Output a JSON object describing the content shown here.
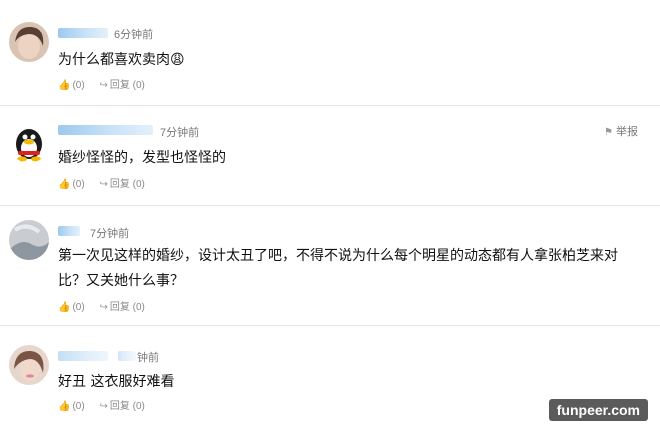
{
  "comments": [
    {
      "time": "6分钟前",
      "text": "为什么都喜欢卖肉😩",
      "like_count": "(0)",
      "reply_label": "回复",
      "reply_count": "(0)"
    },
    {
      "time": "7分钟前",
      "text": "婚纱怪怪的，发型也怪怪的",
      "like_count": "(0)",
      "reply_label": "回复",
      "reply_count": "(0)",
      "report_label": "举报"
    },
    {
      "time": "7分钟前",
      "text_line1": "第一次见这样的婚纱，设计太丑了吧，不得不说为什么每个明星的动态都有人拿张柏芝来对",
      "text_line2": "比？又关她什么事？",
      "like_count": "(0)",
      "reply_label": "回复",
      "reply_count": "(0)"
    },
    {
      "time": "钟前",
      "text": "好丑 这衣服好难看",
      "like_count": "(0)",
      "reply_label": "回复",
      "reply_count": "(0)"
    }
  ],
  "icons": {
    "like": "thumbs-up-icon",
    "reply": "share-arrow-icon",
    "report": "flag-icon"
  },
  "watermark": "funpeer.com"
}
